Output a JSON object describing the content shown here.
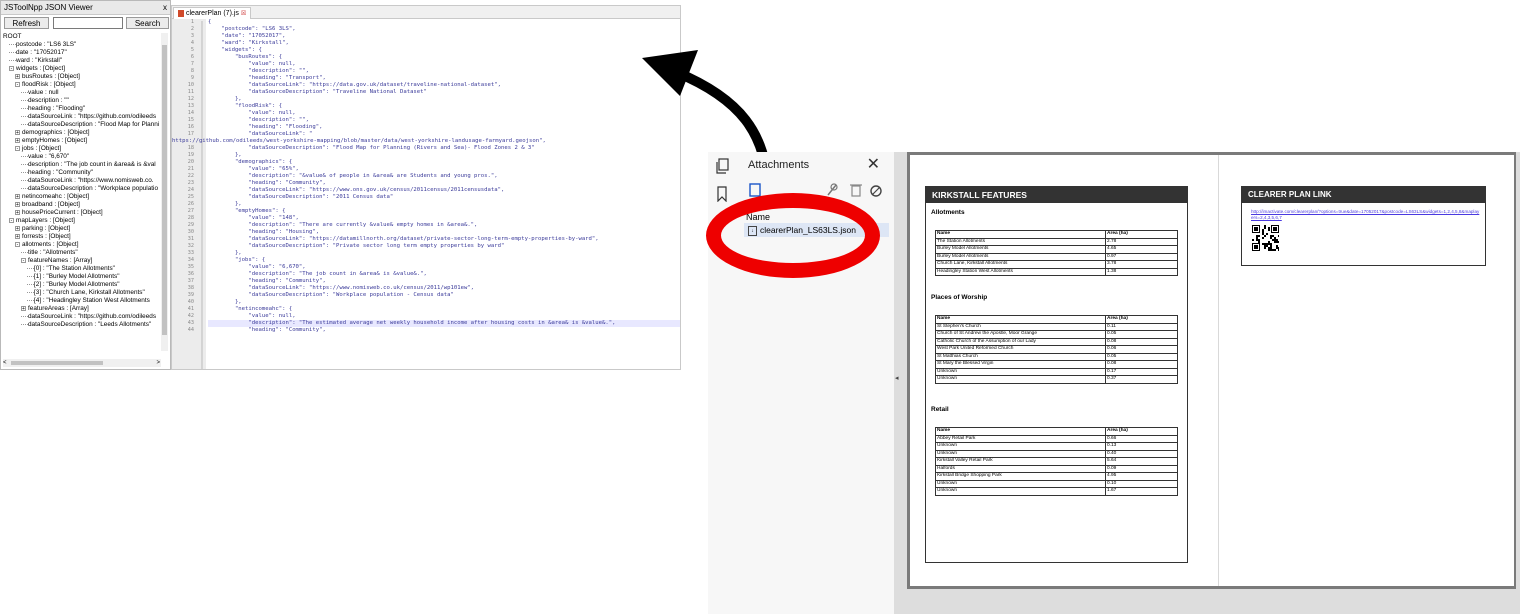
{
  "json_viewer": {
    "title": "JSToolNpp JSON Viewer",
    "close": "x",
    "refresh_label": "Refresh",
    "search_label": "Search",
    "search_value": "",
    "tree": [
      {
        "indent": 0,
        "toggle": "",
        "text": "ROOT"
      },
      {
        "indent": 1,
        "toggle": "",
        "text": "postcode : \"LS6 3LS\""
      },
      {
        "indent": 1,
        "toggle": "",
        "text": "date : \"17052017\""
      },
      {
        "indent": 1,
        "toggle": "",
        "text": "ward : \"Kirkstall\""
      },
      {
        "indent": 1,
        "toggle": "-",
        "text": "widgets : [Object]"
      },
      {
        "indent": 2,
        "toggle": "+",
        "text": "busRoutes : [Object]"
      },
      {
        "indent": 2,
        "toggle": "-",
        "text": "floodRisk : [Object]"
      },
      {
        "indent": 3,
        "toggle": "",
        "text": "value : null"
      },
      {
        "indent": 3,
        "toggle": "",
        "text": "description : \"\""
      },
      {
        "indent": 3,
        "toggle": "",
        "text": "heading : \"Flooding\""
      },
      {
        "indent": 3,
        "toggle": "",
        "text": "dataSourceLink : \"https://github.com/odileeds"
      },
      {
        "indent": 3,
        "toggle": "",
        "text": "dataSourceDescription : \"Flood Map for Planni"
      },
      {
        "indent": 2,
        "toggle": "+",
        "text": "demographics : [Object]"
      },
      {
        "indent": 2,
        "toggle": "+",
        "text": "emptyHomes : [Object]"
      },
      {
        "indent": 2,
        "toggle": "-",
        "text": "jobs : [Object]"
      },
      {
        "indent": 3,
        "toggle": "",
        "text": "value : \"6,670\""
      },
      {
        "indent": 3,
        "toggle": "",
        "text": "description : \"The job count in &area& is &val"
      },
      {
        "indent": 3,
        "toggle": "",
        "text": "heading : \"Community\""
      },
      {
        "indent": 3,
        "toggle": "",
        "text": "dataSourceLink : \"https://www.nomisweb.co."
      },
      {
        "indent": 3,
        "toggle": "",
        "text": "dataSourceDescription : \"Workplace populatio"
      },
      {
        "indent": 2,
        "toggle": "+",
        "text": "netincomeahc : [Object]"
      },
      {
        "indent": 2,
        "toggle": "+",
        "text": "broadband : [Object]"
      },
      {
        "indent": 2,
        "toggle": "+",
        "text": "housePriceCurrent : [Object]"
      },
      {
        "indent": 1,
        "toggle": "-",
        "text": "mapLayers : [Object]"
      },
      {
        "indent": 2,
        "toggle": "+",
        "text": "parking : [Object]"
      },
      {
        "indent": 2,
        "toggle": "+",
        "text": "forrests : [Object]"
      },
      {
        "indent": 2,
        "toggle": "-",
        "text": "allotments : [Object]"
      },
      {
        "indent": 3,
        "toggle": "",
        "text": "title : \"Allotments\""
      },
      {
        "indent": 3,
        "toggle": "-",
        "text": "featureNames : [Array]"
      },
      {
        "indent": 4,
        "toggle": "",
        "text": "[0] : \"The Station Allotments\""
      },
      {
        "indent": 4,
        "toggle": "",
        "text": "[1] : \"Burley Model Allotments\""
      },
      {
        "indent": 4,
        "toggle": "",
        "text": "[2] : \"Burley Model Allotments\""
      },
      {
        "indent": 4,
        "toggle": "",
        "text": "[3] : \"Church Lane, Kirkstall Allotments\""
      },
      {
        "indent": 4,
        "toggle": "",
        "text": "[4] : \"Headingley Station West Allotments"
      },
      {
        "indent": 3,
        "toggle": "+",
        "text": "featureAreas : [Array]"
      },
      {
        "indent": 3,
        "toggle": "",
        "text": "dataSourceLink : \"https://github.com/odileeds"
      },
      {
        "indent": 3,
        "toggle": "",
        "text": "dataSourceDescription : \"Leeds Allotments\""
      }
    ],
    "hscroll_left": "<",
    "hscroll_right": ">"
  },
  "editor": {
    "tab_label": "clearerPlan (7).js",
    "lines": [
      {
        "n": "1",
        "t": "{"
      },
      {
        "n": "2",
        "t": "    \"postcode\": \"LS6 3LS\","
      },
      {
        "n": "3",
        "t": "    \"date\": \"17052017\","
      },
      {
        "n": "4",
        "t": "    \"ward\": \"Kirkstall\","
      },
      {
        "n": "5",
        "t": "    \"widgets\": {"
      },
      {
        "n": "6",
        "t": "        \"busRoutes\": {"
      },
      {
        "n": "7",
        "t": "            \"value\": null,"
      },
      {
        "n": "8",
        "t": "            \"description\": \"\","
      },
      {
        "n": "9",
        "t": "            \"heading\": \"Transport\","
      },
      {
        "n": "10",
        "t": "            \"dataSourceLink\": \"https://data.gov.uk/dataset/traveline-national-dataset\","
      },
      {
        "n": "11",
        "t": "            \"dataSourceDescription\": \"Traveline National Dataset\""
      },
      {
        "n": "12",
        "t": "        },"
      },
      {
        "n": "13",
        "t": "        \"floodRisk\": {"
      },
      {
        "n": "14",
        "t": "            \"value\": null,"
      },
      {
        "n": "15",
        "t": "            \"description\": \"\","
      },
      {
        "n": "16",
        "t": "            \"heading\": \"Flooding\","
      },
      {
        "n": "17",
        "t": "            \"dataSourceLink\": \""
      },
      {
        "n": "",
        "t": "https://github.com/odileeds/west-yorkshire-mapping/blob/master/data/west-yorkshire-landusage-farmyard.geojson\","
      },
      {
        "n": "18",
        "t": "            \"dataSourceDescription\": \"Flood Map for Planning (Rivers and Sea)- Flood Zones 2 & 3\""
      },
      {
        "n": "19",
        "t": "        },"
      },
      {
        "n": "20",
        "t": "        \"demographics\": {"
      },
      {
        "n": "21",
        "t": "            \"value\": \"65%\","
      },
      {
        "n": "22",
        "t": "            \"description\": \"&value& of people in &area& are Students and young pros.\","
      },
      {
        "n": "23",
        "t": "            \"heading\": \"Community\","
      },
      {
        "n": "24",
        "t": "            \"dataSourceLink\": \"https://www.ons.gov.uk/census/2011census/2011censusdata\","
      },
      {
        "n": "25",
        "t": "            \"dataSourceDescription\": \"2011 Census data\""
      },
      {
        "n": "26",
        "t": "        },"
      },
      {
        "n": "27",
        "t": "        \"emptyHomes\": {"
      },
      {
        "n": "28",
        "t": "            \"value\": \"148\","
      },
      {
        "n": "29",
        "t": "            \"description\": \"There are currently &value& empty homes in &area&.\","
      },
      {
        "n": "30",
        "t": "            \"heading\": \"Housing\","
      },
      {
        "n": "31",
        "t": "            \"dataSourceLink\": \"https://datamillnorth.org/dataset/private-sector-long-term-empty-properties-by-ward\","
      },
      {
        "n": "32",
        "t": "            \"dataSourceDescription\": \"Private sector long term empty properties by ward\""
      },
      {
        "n": "33",
        "t": "        },"
      },
      {
        "n": "34",
        "t": "        \"jobs\": {"
      },
      {
        "n": "35",
        "t": "            \"value\": \"6,670\","
      },
      {
        "n": "36",
        "t": "            \"description\": \"The job count in &area& is &value&.\","
      },
      {
        "n": "37",
        "t": "            \"heading\": \"Community\","
      },
      {
        "n": "38",
        "t": "            \"dataSourceLink\": \"https://www.nomisweb.co.uk/census/2011/wp101ew\","
      },
      {
        "n": "39",
        "t": "            \"dataSourceDescription\": \"Workplace population - Census data\""
      },
      {
        "n": "40",
        "t": "        },"
      },
      {
        "n": "41",
        "t": "        \"netincomeahc\": {"
      },
      {
        "n": "42",
        "t": "            \"value\": null,"
      },
      {
        "n": "43",
        "t": "            \"description\": \"The estimated average net weekly household income after housing costs in &area& is &value&.\","
      },
      {
        "n": "44",
        "t": "            \"heading\": \"Community\","
      }
    ]
  },
  "attachments": {
    "title": "Attachments",
    "close": "✕",
    "column_header": "Name",
    "file_name": "clearerPlan_LS63LS.json"
  },
  "pdf": {
    "collapse_glyph": "◂",
    "page1": {
      "header": "KIRKSTALL FEATURES",
      "sections": [
        {
          "title": "Allotments",
          "col_name": "Name",
          "col_area": "Area (ha)",
          "rows": [
            [
              "The Station Allotments",
              "2.78"
            ],
            [
              "Burley Model Allotments",
              "4.65"
            ],
            [
              "Burley Model Allotments",
              "0.97"
            ],
            [
              "Church Lane, Kirkstall Allotments",
              "3.78"
            ],
            [
              "Headingley Station West Allotments",
              "1.38"
            ]
          ]
        },
        {
          "title": "Places of Worship",
          "col_name": "Name",
          "col_area": "Area (ha)",
          "rows": [
            [
              "St Stephen's Church",
              "0.11"
            ],
            [
              "Church of St Andrew the Apostle, Moor Grange",
              "0.05"
            ],
            [
              "Catholic Church of the Assumption of our Lady",
              "0.08"
            ],
            [
              "West Park United Reformed Church",
              "0.06"
            ],
            [
              "St Matthias Church",
              "0.05"
            ],
            [
              "St Mary the Blessed Virgin",
              "0.08"
            ],
            [
              "Unknown",
              "0.17"
            ],
            [
              "Unknown",
              "0.37"
            ]
          ]
        },
        {
          "title": "Retail",
          "col_name": "Name",
          "col_area": "Area (ha)",
          "rows": [
            [
              "Abbey Retail Park",
              "0.66"
            ],
            [
              "Unknown",
              "0.13"
            ],
            [
              "Unknown",
              "0.40"
            ],
            [
              "Kirkstall Valley Retail Park",
              "5.64"
            ],
            [
              "Halfords",
              "0.09"
            ],
            [
              "Kirkstall Bridge Shopping Park",
              "4.95"
            ],
            [
              "Unknown",
              "0.10"
            ],
            [
              "Unknown",
              "1.67"
            ]
          ]
        }
      ]
    },
    "page2": {
      "header": "CLEARER PLAN LINK",
      "link": "http://imactivate.com/clearerplan/?options=true&date=17052017&postcode=LS63LS&widgets=1,2,4,5,8&maplayers=2,4,3,5,6,7"
    }
  }
}
